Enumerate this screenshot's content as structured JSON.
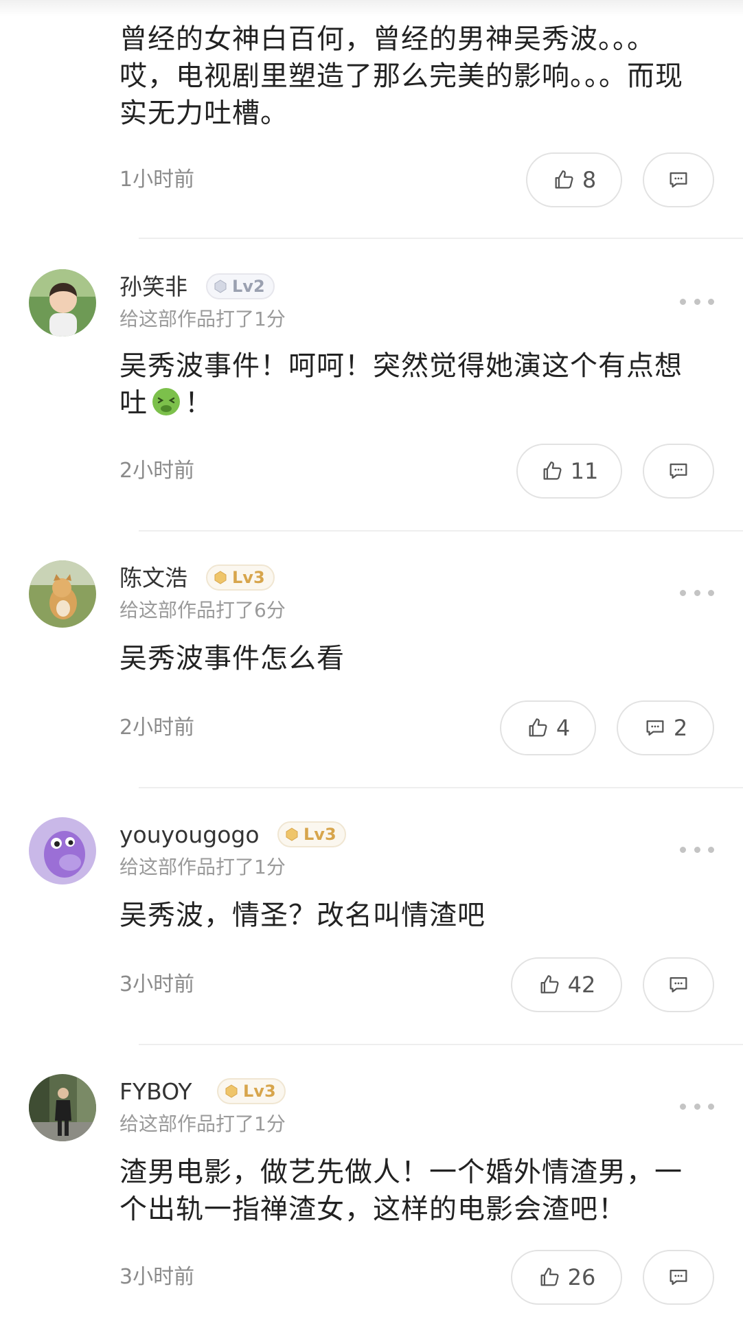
{
  "comments": [
    {
      "text": "曾经的女神白百何，曾经的男神吴秀波。。。哎，电视剧里塑造了那么完美的影响。。。而现实无力吐槽。",
      "time": "1小时前",
      "likes": "8",
      "replies": ""
    },
    {
      "username": "孙笑非",
      "level": "Lv2",
      "rating": "给这部作品打了1分",
      "text": "吴秀波事件！呵呵！突然觉得她演这个有点想吐",
      "text_suffix": "！",
      "time": "2小时前",
      "likes": "11",
      "replies": ""
    },
    {
      "username": "陈文浩",
      "level": "Lv3",
      "rating": "给这部作品打了6分",
      "text": "吴秀波事件怎么看",
      "time": "2小时前",
      "likes": "4",
      "replies": "2"
    },
    {
      "username": "youyougogo",
      "level": "Lv3",
      "rating": "给这部作品打了1分",
      "text": "吴秀波，情圣？改名叫情渣吧",
      "time": "3小时前",
      "likes": "42",
      "replies": ""
    },
    {
      "username": "FYBOY",
      "level": "Lv3",
      "rating": "给这部作品打了1分",
      "text": "渣男电影，做艺先做人！一个婚外情渣男，一个出轨一指禅渣女，这样的电影会渣吧！",
      "time": "3小时前",
      "likes": "26",
      "replies": ""
    }
  ],
  "icons": {
    "like": "thumbs-up-icon",
    "reply": "comment-bubble-icon",
    "more": "more-dots-icon",
    "emoji": "nauseated-face-emoji"
  },
  "colors": {
    "lv2_badge": "#9aa0b0",
    "lv3_badge": "#d7a54c",
    "emoji_green": "#7cc04b"
  }
}
